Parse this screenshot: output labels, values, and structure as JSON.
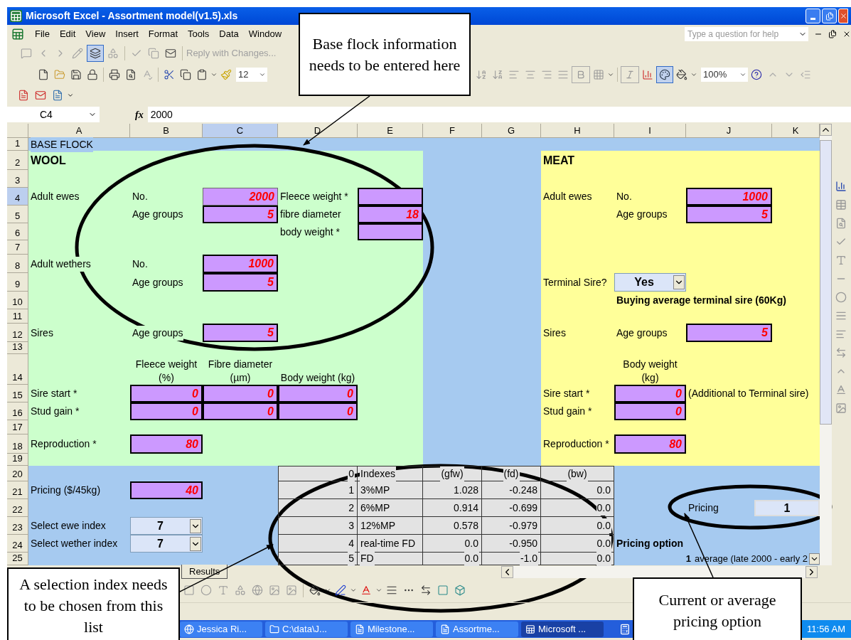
{
  "window": {
    "title": "Microsoft Excel - Assortment model(v1.5).xls"
  },
  "menu": [
    {
      "label": "File"
    },
    {
      "label": "Edit"
    },
    {
      "label": "View"
    },
    {
      "label": "Insert"
    },
    {
      "label": "Format"
    },
    {
      "label": "Tools"
    },
    {
      "label": "Data"
    },
    {
      "label": "Window"
    }
  ],
  "help_field": {
    "placeholder": "Type a question for help"
  },
  "reviewing_toolbar": {
    "reply_label": "Reply with Changes..."
  },
  "font_size": "12",
  "zoom": "100%",
  "formula_bar": {
    "cell": "C4",
    "function_symbol": "fx",
    "formula": "2000"
  },
  "columns": [
    {
      "label": "A",
      "selected": false
    },
    {
      "label": "B",
      "selected": false
    },
    {
      "label": "C",
      "selected": true
    },
    {
      "label": "D",
      "selected": false
    },
    {
      "label": "E",
      "selected": false
    },
    {
      "label": "F",
      "selected": false
    },
    {
      "label": "G",
      "selected": false
    },
    {
      "label": "H",
      "selected": false
    },
    {
      "label": "I",
      "selected": false
    },
    {
      "label": "J",
      "selected": false
    },
    {
      "label": "K",
      "selected": false
    }
  ],
  "rows": [
    {
      "label": "1",
      "selected": false
    },
    {
      "label": "2",
      "selected": false
    },
    {
      "label": "3",
      "selected": false
    },
    {
      "label": "4",
      "selected": true
    },
    {
      "label": "5",
      "selected": false
    },
    {
      "label": "6",
      "selected": false
    },
    {
      "label": "7",
      "selected": false
    },
    {
      "label": "8",
      "selected": false
    },
    {
      "label": "9",
      "selected": false
    },
    {
      "label": "10",
      "selected": false
    },
    {
      "label": "11",
      "selected": false
    },
    {
      "label": "12",
      "selected": false
    },
    {
      "label": "13",
      "selected": false
    },
    {
      "label": "14",
      "selected": false
    },
    {
      "label": "15",
      "selected": false
    },
    {
      "label": "16",
      "selected": false
    },
    {
      "label": "17",
      "selected": false
    },
    {
      "label": "18",
      "selected": false
    },
    {
      "label": "19",
      "selected": false
    },
    {
      "label": "20",
      "selected": false
    },
    {
      "label": "21",
      "selected": false
    },
    {
      "label": "22",
      "selected": false
    },
    {
      "label": "23",
      "selected": false
    },
    {
      "label": "24",
      "selected": false
    },
    {
      "label": "25",
      "selected": false
    }
  ],
  "cells": [
    {
      "kind": "label",
      "text": "BASE FLOCK"
    },
    {
      "kind": "heading",
      "text": "WOOL"
    },
    {
      "kind": "heading",
      "text": "MEAT"
    },
    {
      "kind": "label",
      "text": "Adult ewes"
    },
    {
      "kind": "label",
      "text": "No."
    },
    {
      "kind": "input",
      "text": "2000",
      "selected": true
    },
    {
      "kind": "label",
      "text": "Fleece weight *"
    },
    {
      "kind": "input",
      "selected": false
    },
    {
      "kind": "label",
      "text": "Adult ewes"
    },
    {
      "kind": "label",
      "text": "No."
    },
    {
      "kind": "input",
      "text": "1000",
      "selected": false
    },
    {
      "kind": "label",
      "text": "Age groups"
    },
    {
      "kind": "input",
      "text": "5",
      "selected": false
    },
    {
      "kind": "label",
      "text": "fibre diameter"
    },
    {
      "kind": "input",
      "text": "18",
      "selected": false
    },
    {
      "kind": "label",
      "text": "Age groups"
    },
    {
      "kind": "input",
      "text": "5",
      "selected": false
    },
    {
      "kind": "label",
      "text": "body weight *"
    },
    {
      "kind": "input",
      "selected": false
    },
    {
      "kind": "label",
      "text": "Adult wethers"
    },
    {
      "kind": "label",
      "text": "No."
    },
    {
      "kind": "input",
      "text": "1000",
      "selected": false
    },
    {
      "kind": "label",
      "text": "Age groups"
    },
    {
      "kind": "input",
      "text": "5",
      "selected": false
    },
    {
      "kind": "label",
      "text": "Terminal Sire?"
    },
    {
      "kind": "dropdown",
      "text": "Yes"
    },
    {
      "kind": "note",
      "text": "Buying average terminal sire (60Kg)"
    },
    {
      "kind": "label",
      "text": "Sires"
    },
    {
      "kind": "label",
      "text": "Age groups"
    },
    {
      "kind": "input",
      "text": "5",
      "selected": false
    },
    {
      "kind": "label",
      "text": "Sires"
    },
    {
      "kind": "label",
      "text": "Age groups"
    },
    {
      "kind": "input",
      "text": "5",
      "selected": false
    },
    {
      "kind": "header",
      "text": "Fleece weight (%)"
    },
    {
      "kind": "header",
      "text": "Fibre diameter (µm)"
    },
    {
      "kind": "header",
      "text": "Body weight (kg)"
    },
    {
      "kind": "header",
      "text": "Body weight (kg)"
    },
    {
      "kind": "label",
      "text": "Sire start *"
    },
    {
      "kind": "input",
      "text": "0",
      "selected": false
    },
    {
      "kind": "input",
      "text": "0",
      "selected": false
    },
    {
      "kind": "input",
      "text": "0",
      "selected": false
    },
    {
      "kind": "label",
      "text": "Sire start *"
    },
    {
      "kind": "input",
      "text": "0",
      "selected": false
    },
    {
      "kind": "label",
      "text": "(Additional to Terminal sire)"
    },
    {
      "kind": "label",
      "text": "Stud gain *"
    },
    {
      "kind": "input",
      "text": "0",
      "selected": false
    },
    {
      "kind": "input",
      "text": "0",
      "selected": false
    },
    {
      "kind": "input",
      "text": "0",
      "selected": false
    },
    {
      "kind": "label",
      "text": "Stud gain *"
    },
    {
      "kind": "input",
      "text": "0",
      "selected": false
    },
    {
      "kind": "label",
      "text": "Reproduction *"
    },
    {
      "kind": "input",
      "text": "80",
      "selected": false
    },
    {
      "kind": "label",
      "text": "Reproduction *"
    },
    {
      "kind": "input",
      "text": "80",
      "selected": false
    },
    {
      "kind": "label",
      "text": "Pricing ($/45kg)"
    },
    {
      "kind": "input",
      "text": "40",
      "selected": false
    },
    {
      "kind": "label",
      "text": "Pricing"
    },
    {
      "kind": "value",
      "text": "1"
    },
    {
      "kind": "label",
      "text": "Select ewe index"
    },
    {
      "kind": "dropdown",
      "text": "7"
    },
    {
      "kind": "label",
      "text": "Select wether index"
    },
    {
      "kind": "dropdown",
      "text": "7"
    },
    {
      "kind": "note",
      "text": "Pricing option"
    }
  ],
  "index_table": {
    "rows": [
      [
        "0",
        "Indexes",
        "(gfw)",
        "(fd)",
        "(bw)"
      ],
      [
        "1",
        "3%MP",
        "1.028",
        "-0.248",
        "0.0"
      ],
      [
        "2",
        "6%MP",
        "0.914",
        "-0.699",
        "0.0"
      ],
      [
        "3",
        "12%MP",
        "0.578",
        "-0.979",
        "0.0"
      ],
      [
        "4",
        "real-time FD",
        "0.0",
        "-0.950",
        "0.0"
      ],
      [
        "5",
        "FD",
        "0.0",
        "-1.0",
        "0.0"
      ]
    ]
  },
  "pricing_combo": {
    "number": "1",
    "text": "average (late 2000 - early 2"
  },
  "sheet_tabs": [
    {
      "label": "Results",
      "selected": false
    }
  ],
  "taskbar": {
    "items": [
      {
        "label": "Jessica Ri...",
        "selected": false
      },
      {
        "label": "C:\\data\\J...",
        "selected": false
      },
      {
        "label": "Milestone...",
        "selected": false
      },
      {
        "label": "Assortme...",
        "selected": false
      },
      {
        "label": "Microsoft ...",
        "selected": true
      }
    ],
    "clock": "11:56 AM"
  },
  "callouts": [
    {
      "text": "Base flock information needs to be entered here"
    },
    {
      "text": "A selection index needs to be chosen from this list"
    },
    {
      "text": "Current or average pricing option"
    }
  ]
}
